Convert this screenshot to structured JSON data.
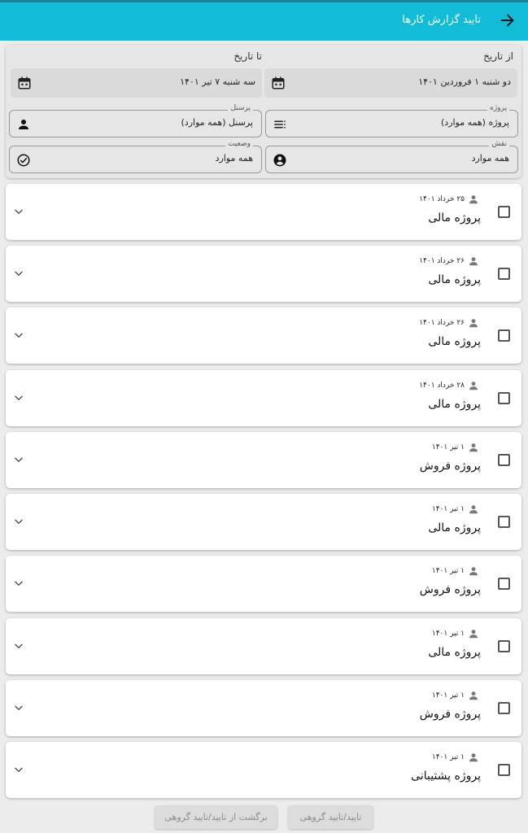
{
  "appbar": {
    "title": "تایید گزارش کارها"
  },
  "filters": {
    "from_label": "از تاریخ",
    "to_label": "تا تاریخ",
    "from_value": "دو شنبه ۱ فروردین ۱۴۰۱",
    "to_value": "سه شنبه ۷ تیر ۱۴۰۱",
    "project_label": "پروژه",
    "project_value": "پروژه (همه موارد)",
    "personnel_label": "پرسنل",
    "personnel_value": "پرسنل (همه موارد)",
    "role_label": "نقش",
    "role_value": "همه موارد",
    "status_label": "وضعیت",
    "status_value": "همه موارد"
  },
  "reports": [
    {
      "date": "۲۵ خرداد ۱۴۰۱",
      "project": "پروژه  مالی"
    },
    {
      "date": "۲۶ خرداد ۱۴۰۱",
      "project": "پروژه  مالی"
    },
    {
      "date": "۲۶ خرداد ۱۴۰۱",
      "project": "پروژه  مالی"
    },
    {
      "date": "۲۸ خرداد ۱۴۰۱",
      "project": "پروژه  مالی"
    },
    {
      "date": "۱ تیر ۱۴۰۱",
      "project": "پروژه فروش"
    },
    {
      "date": "۱ تیر ۱۴۰۱",
      "project": "پروژه  مالی"
    },
    {
      "date": "۱ تیر ۱۴۰۱",
      "project": "پروژه فروش"
    },
    {
      "date": "۱ تیر ۱۴۰۱",
      "project": "پروژه  مالی"
    },
    {
      "date": "۱ تیر ۱۴۰۱",
      "project": "پروژه فروش"
    },
    {
      "date": "۱ تیر ۱۴۰۱",
      "project": "پروژه پشتیبانی"
    }
  ],
  "actions": {
    "approve_group": "تایید/تایید گروهی",
    "revert_group": "برگشت از تایید/تایید گروهی"
  }
}
